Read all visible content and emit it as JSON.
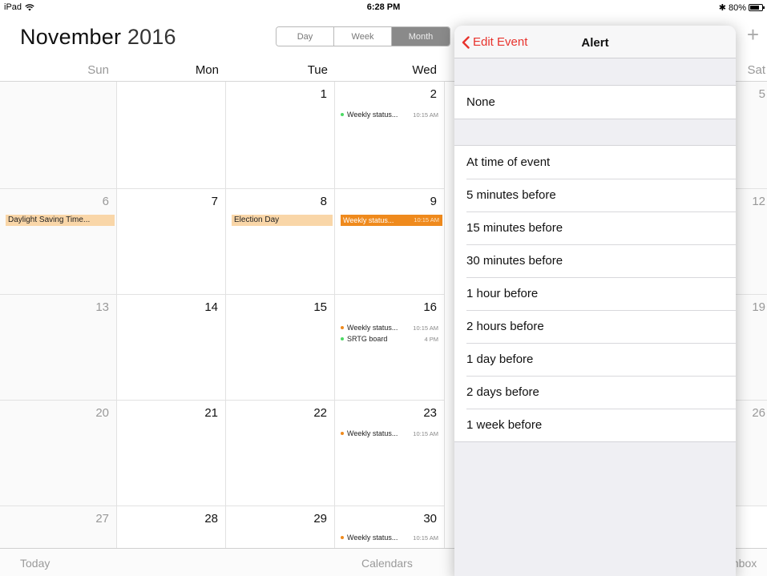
{
  "status": {
    "device": "iPad",
    "time": "6:28 PM",
    "battery": "80%",
    "battery_level": 0.8
  },
  "header": {
    "month": "November",
    "year": "2016",
    "add_icon": "plus-icon"
  },
  "view_tabs": [
    {
      "label": "Day"
    },
    {
      "label": "Week"
    },
    {
      "label": "Month"
    }
  ],
  "weekdays": [
    "Sun",
    "Mon",
    "Tue",
    "Wed",
    "Sat"
  ],
  "calendar": {
    "sun": [
      "",
      "6",
      "13",
      "20",
      "27"
    ],
    "mon": [
      "",
      "7",
      "14",
      "21",
      "28"
    ],
    "tue": [
      "1",
      "8",
      "15",
      "22",
      "29"
    ],
    "wed": [
      "2",
      "9",
      "16",
      "23",
      "30"
    ],
    "sat": [
      "5",
      "12",
      "19",
      "26",
      ""
    ]
  },
  "events": {
    "weekly_status": "Weekly status...",
    "weekly_time": "10:15 AM",
    "srtg": "SRTG board",
    "srtg_time": "4 PM",
    "daylight": "Daylight Saving Time...",
    "election": "Election Day"
  },
  "toolbar": {
    "today": "Today",
    "calendars": "Calendars",
    "inbox": "Inbox"
  },
  "popover": {
    "back_label": "Edit Event",
    "title": "Alert",
    "none_option": "None",
    "options": [
      "At time of event",
      "5 minutes before",
      "15 minutes before",
      "30 minutes before",
      "1 hour before",
      "2 hours before",
      "1 day before",
      "2 days before",
      "1 week before"
    ]
  },
  "colors": {
    "accent": "#e8322c",
    "orange": "#ef8a1d",
    "green": "#4cd964",
    "allday": "#f9d6a8"
  }
}
